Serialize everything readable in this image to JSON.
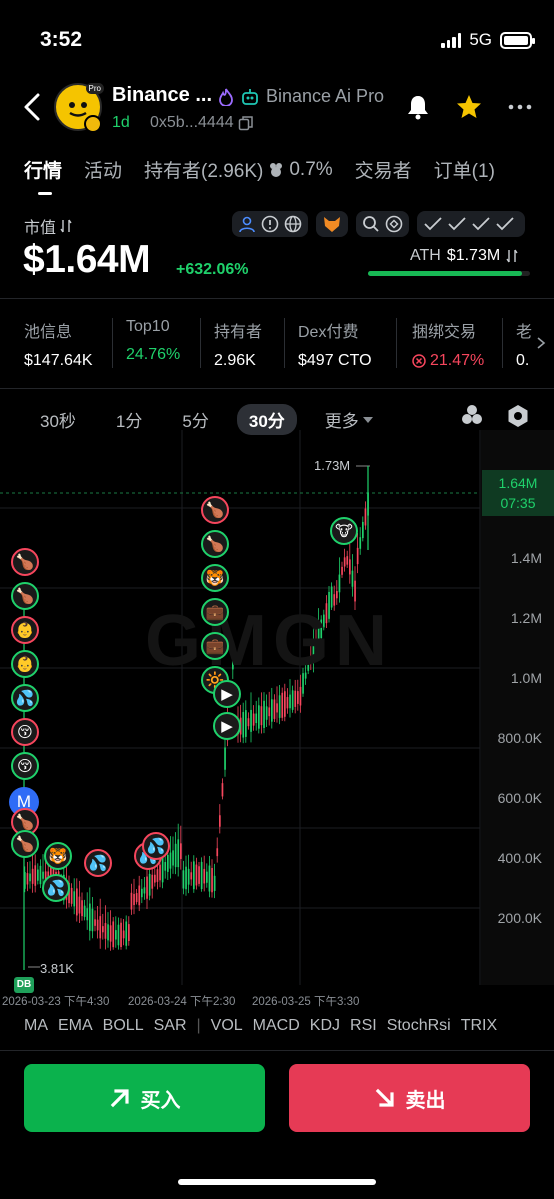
{
  "status": {
    "time": "3:52",
    "network": "5G"
  },
  "header": {
    "token_name": "Binance ...",
    "alias": "Binance Ai Pro",
    "age": "1d",
    "address": "0x5b...4444"
  },
  "tabs": [
    {
      "label": "行情",
      "active": true
    },
    {
      "label": "活动"
    },
    {
      "label": "持有者(2.96K)"
    },
    {
      "label": "0.7%"
    },
    {
      "label": "交易者"
    },
    {
      "label": "订单(1)"
    }
  ],
  "market": {
    "label": "市值",
    "value": "$1.64M",
    "change": "+632.06%",
    "ath_label": "ATH",
    "ath_value": "$1.73M",
    "ath_progress": 0.95
  },
  "info": [
    {
      "key": "池信息",
      "value": "$147.64K"
    },
    {
      "key": "Top10",
      "value": "24.76%",
      "tone": "green"
    },
    {
      "key": "持有者",
      "value": "2.96K"
    },
    {
      "key": "Dex付费",
      "value": "$497 CTO"
    },
    {
      "key": "捆绑交易",
      "value": "21.47%",
      "tone": "red"
    },
    {
      "key": "老",
      "value": "0."
    }
  ],
  "timeframes": [
    "30秒",
    "1分",
    "5分",
    "30分",
    "更多"
  ],
  "selected_timeframe": "30分",
  "chart_data": {
    "type": "candlestick",
    "y_ticks": [
      "1.4M",
      "1.2M",
      "1.0M",
      "800.0K",
      "600.0K",
      "400.0K",
      "200.0K"
    ],
    "current_price": "1.64M",
    "countdown": "07:35",
    "high_label": "1.73M",
    "low_label": "3.81K",
    "x_ticks": [
      "2026-03-23 下午4:30",
      "2026-03-24 下午2:30",
      "2026-03-25 下午3:30"
    ],
    "watermark": "GMGN",
    "db_badge": "DB",
    "m_badge": "M"
  },
  "indicators": [
    "MA",
    "EMA",
    "BOLL",
    "SAR",
    "|",
    "VOL",
    "MACD",
    "KDJ",
    "RSI",
    "StochRsi",
    "TRIX"
  ],
  "actions": {
    "buy": "买入",
    "sell": "卖出"
  },
  "colors": {
    "up": "#1fd16b",
    "down": "#f6465d",
    "buy_bg": "#0bb24d",
    "sell_bg": "#e63a55"
  }
}
